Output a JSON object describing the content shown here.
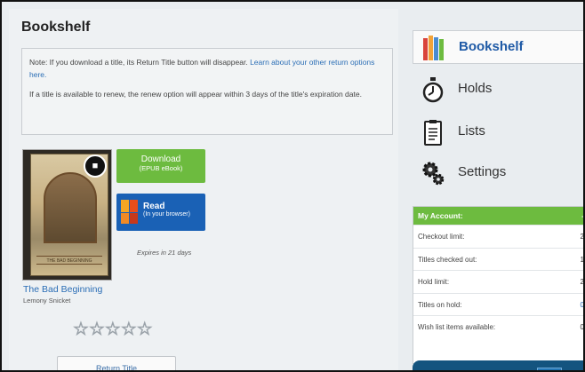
{
  "page": {
    "title": "Bookshelf"
  },
  "note": {
    "line1_text": "Note: If you download a title, its Return Title button will disappear. ",
    "line1_link": "Learn about your other return options here.",
    "line2": "If a title is available to renew, the renew option will appear within 3 days of the title's expiration date."
  },
  "book": {
    "cover_banner": "THE BAD BEGINNING",
    "badge_icon": "book-open-icon",
    "title": "The Bad Beginning",
    "author": "Lemony Snicket",
    "expires": "Expires in 21 days",
    "rating": {
      "value": 0,
      "max": 5,
      "star_glyph": "☆"
    },
    "download": {
      "label": "Download",
      "sublabel": "(EPUB eBook)"
    },
    "read": {
      "label": "Read",
      "sublabel": "(In your browser)"
    },
    "return_label": "Return Title"
  },
  "nav": {
    "items": [
      {
        "label": "Bookshelf",
        "icon": "books-icon",
        "active": true
      },
      {
        "label": "Holds",
        "icon": "stopwatch-icon",
        "active": false
      },
      {
        "label": "Lists",
        "icon": "clipboard-icon",
        "active": false
      },
      {
        "label": "Settings",
        "icon": "gears-icon",
        "active": false
      }
    ]
  },
  "account": {
    "header": "My Account:",
    "header_value": "-",
    "rows": [
      {
        "label": "Checkout limit:",
        "value": "2"
      },
      {
        "label": "Titles checked out:",
        "value": "1"
      },
      {
        "label": "Hold limit:",
        "value": "2"
      },
      {
        "label": "Titles on hold:",
        "value": "0"
      },
      {
        "label": "Wish list items available:",
        "value": "0"
      }
    ]
  },
  "colors": {
    "accent_green": "#6dbb3f",
    "read_blue": "#1a61b5",
    "link_blue": "#2a6db5",
    "nav_active": "#1f5aa6"
  }
}
